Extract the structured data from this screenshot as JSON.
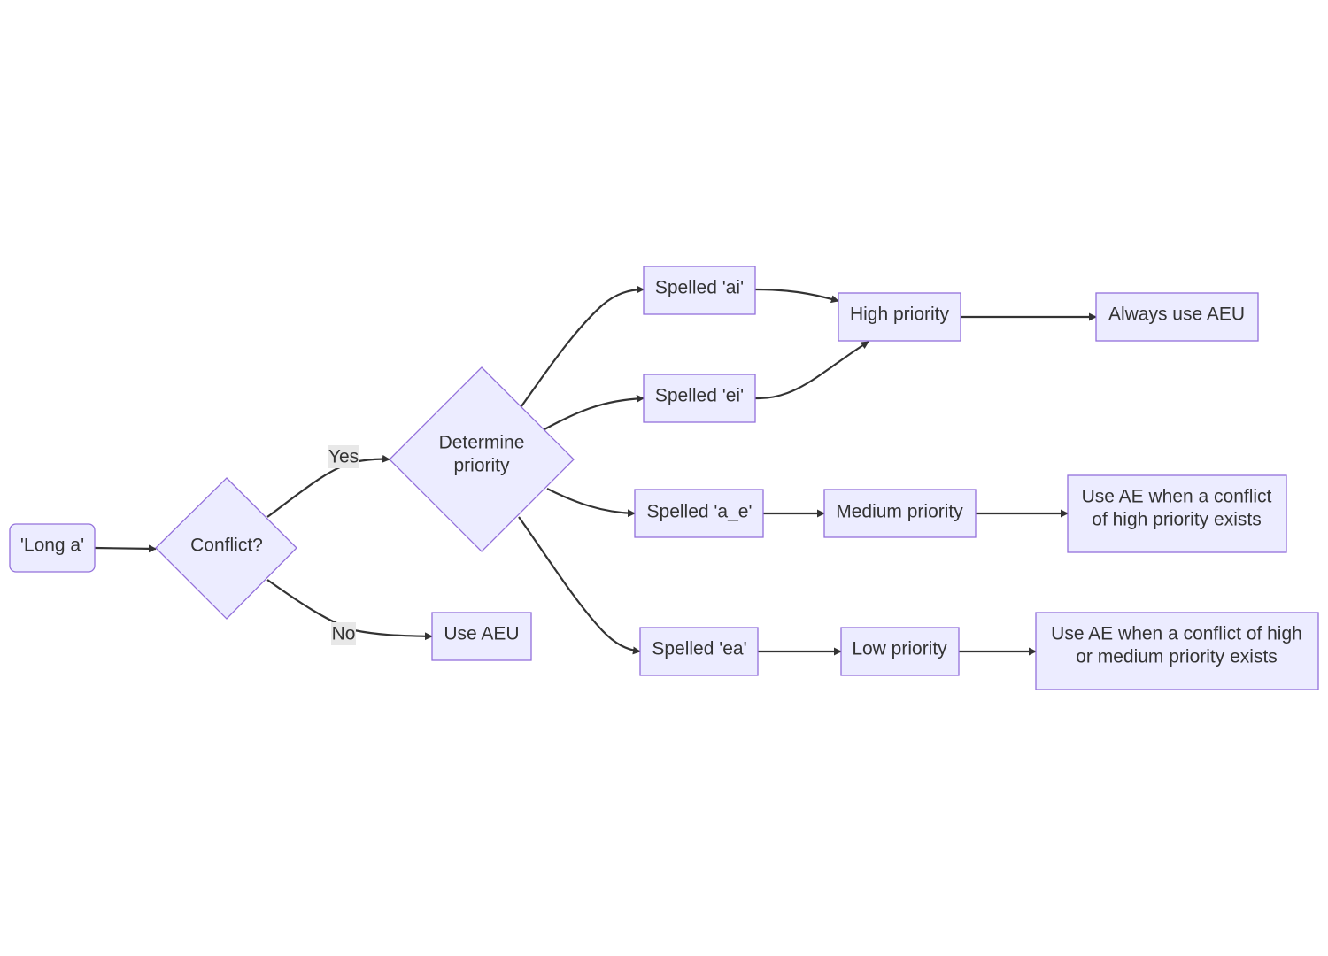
{
  "colors": {
    "node_fill": "#ECECFF",
    "node_stroke": "#9370DB",
    "edge": "#333333",
    "edge_label_bg": "#e8e8e8",
    "text": "#333333"
  },
  "nodes": {
    "start": {
      "lines": [
        "'Long a'"
      ],
      "shape": "rounded-rect"
    },
    "conflict": {
      "lines": [
        "Conflict?"
      ],
      "shape": "diamond"
    },
    "determine": {
      "lines": [
        "Determine",
        "priority"
      ],
      "shape": "diamond"
    },
    "use_aeu": {
      "lines": [
        "Use AEU"
      ],
      "shape": "rect"
    },
    "spelled_ai": {
      "lines": [
        "Spelled 'ai'"
      ],
      "shape": "rect"
    },
    "spelled_ei": {
      "lines": [
        "Spelled 'ei'"
      ],
      "shape": "rect"
    },
    "spelled_a_e": {
      "lines": [
        "Spelled 'a_e'"
      ],
      "shape": "rect"
    },
    "spelled_ea": {
      "lines": [
        "Spelled 'ea'"
      ],
      "shape": "rect"
    },
    "high": {
      "lines": [
        "High priority"
      ],
      "shape": "rect"
    },
    "medium": {
      "lines": [
        "Medium priority"
      ],
      "shape": "rect"
    },
    "low": {
      "lines": [
        "Low priority"
      ],
      "shape": "rect"
    },
    "always_aeu": {
      "lines": [
        "Always use AEU"
      ],
      "shape": "rect"
    },
    "use_ae_high": {
      "lines": [
        "Use AE when a conflict",
        "of high priority exists"
      ],
      "shape": "rect"
    },
    "use_ae_high_medium": {
      "lines": [
        "Use AE when a conflict of high",
        "or medium priority exists"
      ],
      "shape": "rect"
    }
  },
  "edges": [
    {
      "from": "start",
      "to": "conflict",
      "label": ""
    },
    {
      "from": "conflict",
      "to": "determine",
      "label": "Yes"
    },
    {
      "from": "conflict",
      "to": "use_aeu",
      "label": "No"
    },
    {
      "from": "determine",
      "to": "spelled_ai",
      "label": ""
    },
    {
      "from": "determine",
      "to": "spelled_ei",
      "label": ""
    },
    {
      "from": "determine",
      "to": "spelled_a_e",
      "label": ""
    },
    {
      "from": "determine",
      "to": "spelled_ea",
      "label": ""
    },
    {
      "from": "spelled_ai",
      "to": "high",
      "label": ""
    },
    {
      "from": "spelled_ei",
      "to": "high",
      "label": ""
    },
    {
      "from": "spelled_a_e",
      "to": "medium",
      "label": ""
    },
    {
      "from": "spelled_ea",
      "to": "low",
      "label": ""
    },
    {
      "from": "high",
      "to": "always_aeu",
      "label": ""
    },
    {
      "from": "medium",
      "to": "use_ae_high",
      "label": ""
    },
    {
      "from": "low",
      "to": "use_ae_high_medium",
      "label": ""
    }
  ]
}
